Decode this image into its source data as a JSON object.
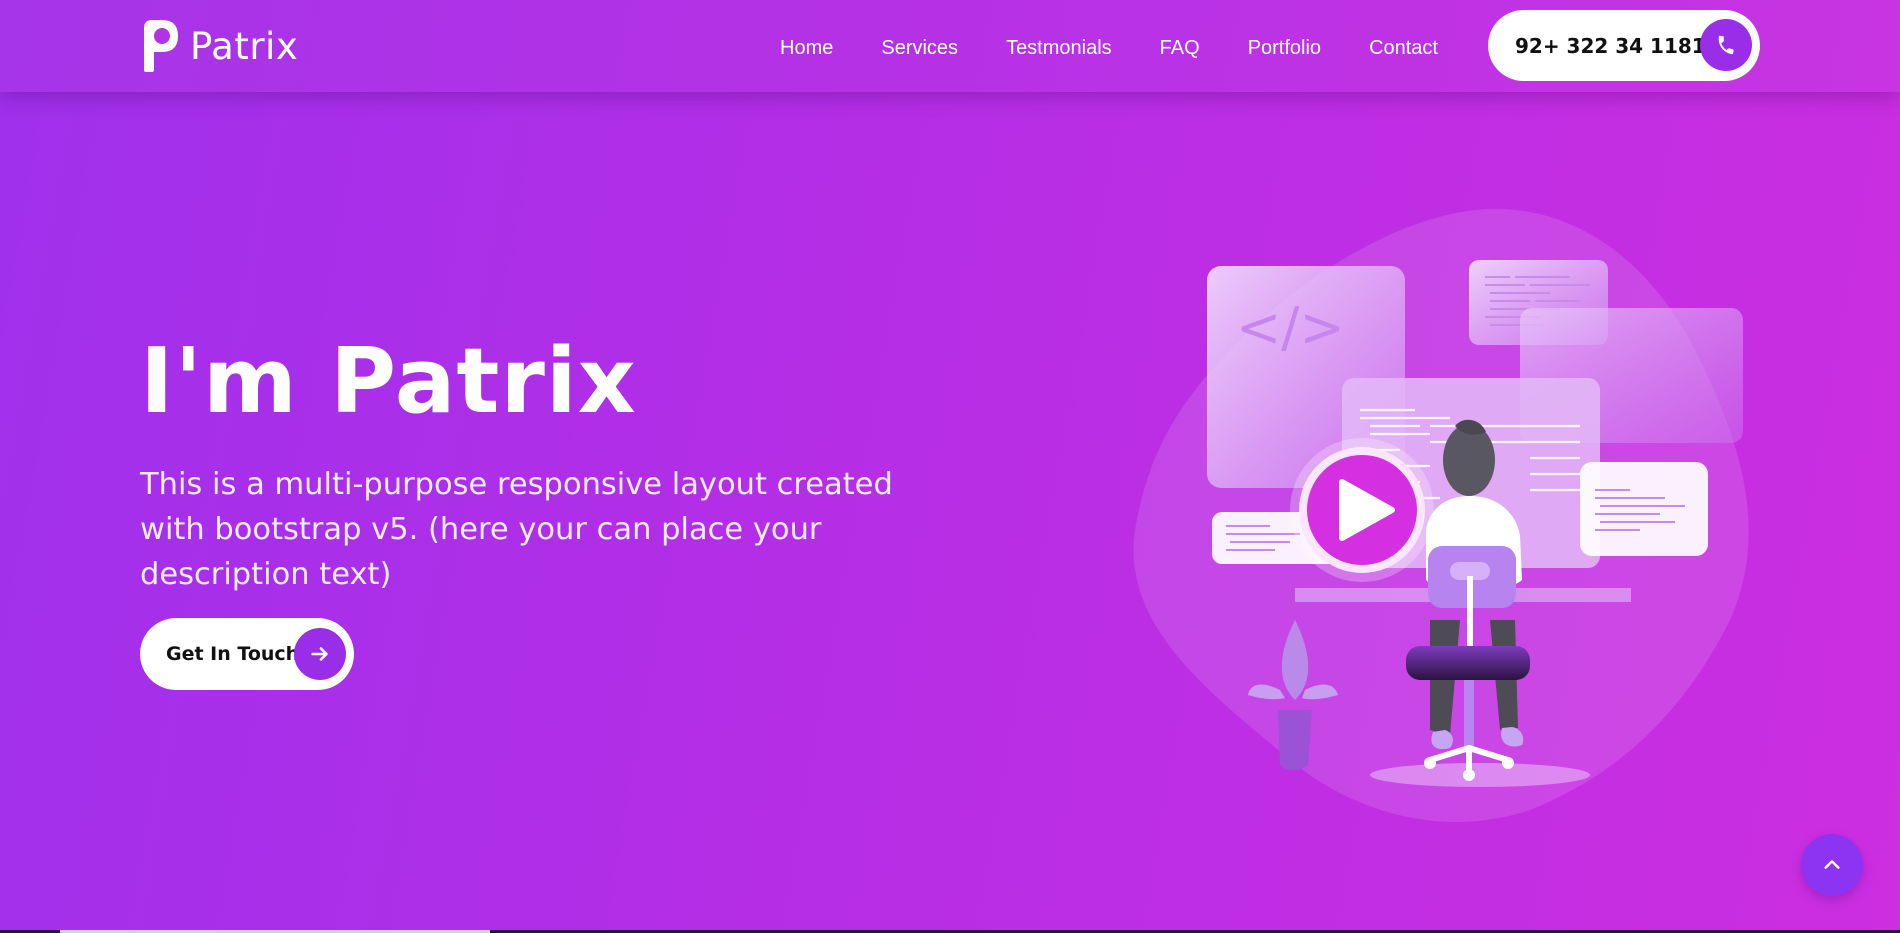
{
  "brand": {
    "name": "Patrix",
    "icon": "brand-p-logo"
  },
  "nav": {
    "links": [
      "Home",
      "Services",
      "Testmonials",
      "FAQ",
      "Portfolio",
      "Contact"
    ],
    "phone": "92+ 322 34 11811",
    "phone_icon": "phone-icon"
  },
  "hero": {
    "title": "I'm Patrix",
    "description": "This is a multi-purpose responsive layout created with bootstrap v5. (here your can place your description text)",
    "cta_label": "Get In Touch",
    "cta_icon": "arrow-right-icon"
  },
  "illustration": {
    "code_glyph": "</>",
    "play_icon": "play-icon"
  },
  "back_to_top_icon": "chevron-up-icon",
  "colors": {
    "gradient_start": "#a030ec",
    "gradient_end": "#cc2ee0",
    "accent": "#9a2ee8",
    "button_bg": "#ffffff",
    "play_button": "#d42fe0"
  }
}
